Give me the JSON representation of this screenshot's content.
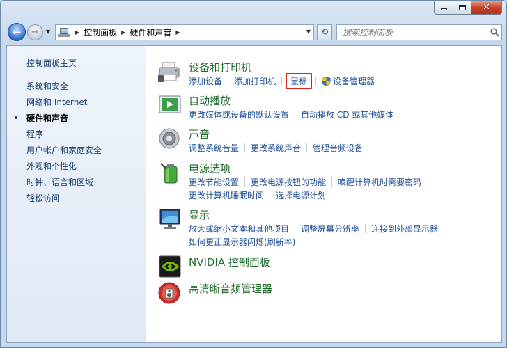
{
  "addressbar": {
    "crumbs": [
      "控制面板",
      "硬件和声音"
    ]
  },
  "search": {
    "placeholder": "搜索控制面板"
  },
  "sidebar": {
    "items": [
      {
        "label": "控制面板主页"
      },
      {
        "label": "系统和安全"
      },
      {
        "label": "网络和 Internet"
      },
      {
        "label": "硬件和声音"
      },
      {
        "label": "程序"
      },
      {
        "label": "用户帐户和家庭安全"
      },
      {
        "label": "外观和个性化"
      },
      {
        "label": "时钟、语言和区域"
      },
      {
        "label": "轻松访问"
      }
    ]
  },
  "categories": [
    {
      "title": "设备和打印机",
      "links": [
        "添加设备",
        "添加打印机",
        "鼠标",
        "设备管理器"
      ]
    },
    {
      "title": "自动播放",
      "links": [
        "更改媒体或设备的默认设置",
        "自动播放 CD 或其他媒体"
      ]
    },
    {
      "title": "声音",
      "links": [
        "调整系统音量",
        "更改系统声音",
        "管理音频设备"
      ]
    },
    {
      "title": "电源选项",
      "links": [
        "更改节能设置",
        "更改电源按钮的功能",
        "唤醒计算机时需要密码",
        "更改计算机睡眠时间",
        "选择电源计划"
      ]
    },
    {
      "title": "显示",
      "links": [
        "放大或缩小文本和其他项目",
        "调整屏幕分辨率",
        "连接到外部显示器",
        "如何更正显示器闪烁(刷新率)"
      ]
    },
    {
      "title": "NVIDIA 控制面板",
      "links": []
    },
    {
      "title": "高清晰音频管理器",
      "links": []
    }
  ],
  "colors": {
    "link": "#1e4e9a",
    "category_title": "#1e6b2a",
    "highlight_border": "#d9231a"
  }
}
